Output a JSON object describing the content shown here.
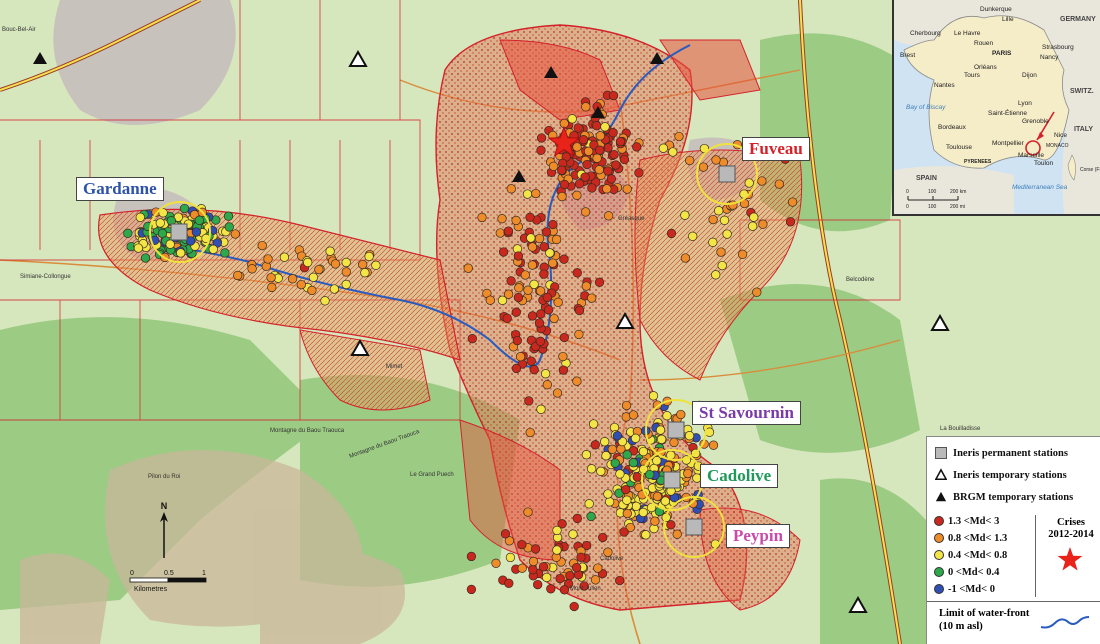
{
  "colors": {
    "magnitude_class_1": "#c8281e",
    "magnitude_class_2": "#ef8c2a",
    "magnitude_class_3": "#f2e545",
    "magnitude_class_4": "#2da84a",
    "magnitude_class_5": "#2f4fb4",
    "crises_star": "#e8231a",
    "waterfront_line": "#2a5bbf",
    "station_square": "#b9b9b9",
    "perimeter_line": "#d4222a",
    "label_fuveau": "#d4222a",
    "label_gardanne": "#2e52a8",
    "label_st_savournin": "#7a3aa8",
    "label_cadolive": "#1f9a5a",
    "label_peypin": "#c94aa8"
  },
  "stations": [
    {
      "id": "gardanne",
      "name": "Gardanne"
    },
    {
      "id": "fuveau",
      "name": "Fuveau"
    },
    {
      "id": "st-savournin",
      "name": "St Savournin"
    },
    {
      "id": "cadolive",
      "name": "Cadolive"
    },
    {
      "id": "peypin",
      "name": "Peypin"
    }
  ],
  "legend": {
    "permanent": "Ineris permanent stations",
    "ineris_temp": "Ineris temporary stations",
    "brgm_temp": "BRGM temporary stations",
    "mag_1": "1.3 <Md< 3",
    "mag_2": "0.8 <Md< 1.3",
    "mag_3": "0.4 <Md< 0.8",
    "mag_4": "0 <Md< 0.4",
    "mag_5": "-1 <Md< 0",
    "crises_title_1": "Crises",
    "crises_title_2": "2012-2014",
    "waterfront_1": "Limit of water-front",
    "waterfront_2": "(10 m asl)"
  },
  "map_labels": {
    "north": "N",
    "scale_ticks": [
      "0",
      "0.5",
      "1"
    ],
    "scale_unit": "Kilometres",
    "places": [
      "Bouc-Bel-Air",
      "Simiane-Collongue",
      "Mimet",
      "Belcodène",
      "Gréasque",
      "Cadolive",
      "Mont Julien",
      "Pilon du Roi",
      "Montagne du Baou Traouca",
      "Montagne du Baou Traouca",
      "Le Grand Puech",
      "La Bouilladisse"
    ]
  },
  "inset": {
    "countries": [
      "GERMANY",
      "SWITZ.",
      "ITALY",
      "SPAIN",
      "MONACO"
    ],
    "cities": [
      "Dunkerque",
      "Lille",
      "Cherbourg",
      "Le Havre",
      "Rouen",
      "PARIS",
      "Strasbourg",
      "Brest",
      "Nancy",
      "Orléans",
      "Nantes",
      "Tours",
      "Dijon",
      "Lyon",
      "Saint-Étienne",
      "Bordeaux",
      "Grenoble",
      "Toulouse",
      "Montpellier",
      "Marseille",
      "Nice",
      "Toulon"
    ],
    "seas": [
      "Bay of Biscay",
      "Mediterranean Sea"
    ],
    "scale_labels": [
      "0",
      "100",
      "200 km",
      "0",
      "100",
      "200 mi"
    ],
    "other": [
      "PYRENEES",
      "Corse (FR.)"
    ]
  }
}
